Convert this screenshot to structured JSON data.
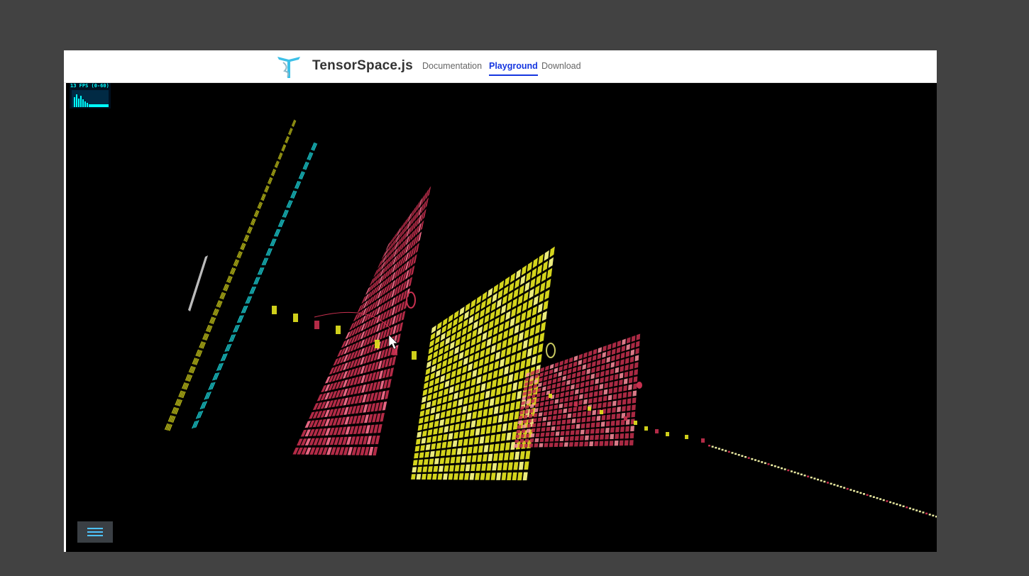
{
  "header": {
    "brand": "TensorSpace.js",
    "nav": [
      {
        "label": "Documentation",
        "active": false
      },
      {
        "label": "Playground",
        "active": true
      },
      {
        "label": "Download",
        "active": false
      }
    ],
    "active_color": "#1536e0"
  },
  "stats": {
    "fps_label": "13 FPS (0-60)"
  },
  "visualization": {
    "colors": {
      "yellow": "#e6e61e",
      "cyan": "#1ad1d6",
      "crimson": "#c7304f",
      "background": "#000000"
    }
  },
  "menu": {
    "icon": "hamburger-menu-icon"
  }
}
